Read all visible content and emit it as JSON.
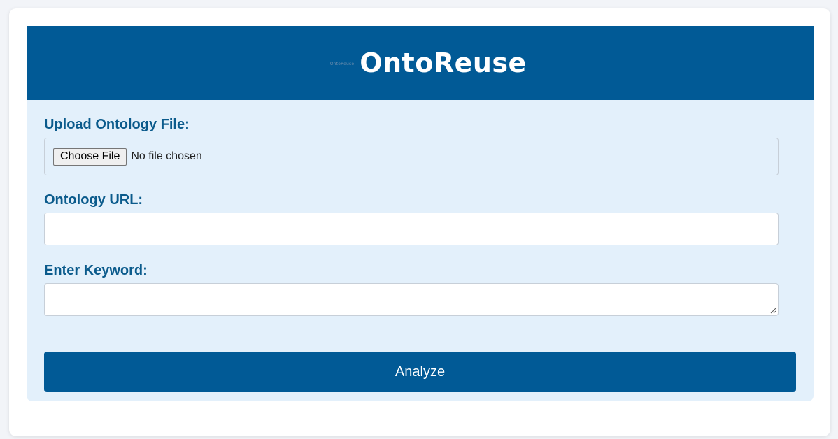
{
  "header": {
    "logo_text": "OntoReuse",
    "title": "OntoReuse",
    "background": "#015a96"
  },
  "form": {
    "upload_label": "Upload Ontology File:",
    "choose_file_label": "Choose File",
    "file_status": "No file chosen",
    "url_label": "Ontology URL:",
    "url_value": "",
    "keyword_label": "Enter Keyword:",
    "keyword_value": "",
    "analyze_label": "Analyze"
  },
  "colors": {
    "accent": "#015a96",
    "label": "#0b5b8c",
    "panel": "#e3f0fb"
  }
}
